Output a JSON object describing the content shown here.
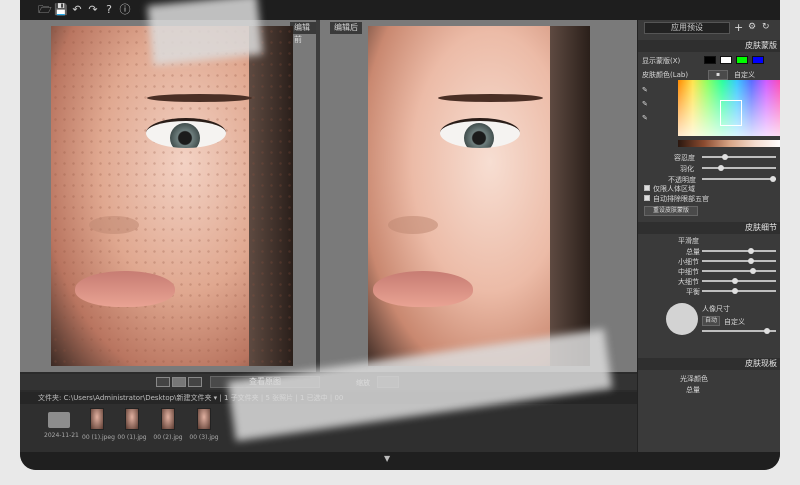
{
  "toolbar": {
    "icons": [
      "open-icon",
      "save-icon",
      "undo-icon",
      "redo-icon",
      "help-icon",
      "info-icon"
    ],
    "glyphs": [
      "🗁",
      "💾",
      "↶",
      "↷",
      "?",
      "ⓘ"
    ]
  },
  "preview": {
    "before_caption": "编辑前",
    "after_caption": "编辑后"
  },
  "viewbar": {
    "view_original_label": "查看原图",
    "zoom_label": "缩放"
  },
  "pathbar": {
    "text": "文件夹: C:\\Users\\Administrator\\Desktop\\新建文件夹 ▾ | 1 子文件夹 | 5 张照片 | 1 已选中 | 00"
  },
  "thumbnails": [
    {
      "label": "2024-11-21",
      "type": "folder"
    },
    {
      "label": "00 (1).jpeg",
      "type": "image"
    },
    {
      "label": "00 (1).jpg",
      "type": "image"
    },
    {
      "label": "00 (2).jpg",
      "type": "image"
    },
    {
      "label": "00 (3).jpg",
      "type": "image"
    }
  ],
  "sidebar": {
    "preset_label": "应用预设",
    "skin_mask": {
      "title": "皮肤蒙版",
      "show_mask_label": "显示蒙版(X)",
      "skin_color_label": "皮肤颜色(Lab)",
      "custom_label": "自定义",
      "tolerance_label": "容忍度",
      "feather_label": "羽化",
      "opacity_label": "不透明度",
      "check1_label": "仅限人体区域",
      "check2_label": "自动排除眼部五官",
      "reset_label": "重设皮肤蒙版"
    },
    "skin_detail": {
      "title": "皮肤细节",
      "smoothness_label": "平滑度",
      "overall_label": "总量",
      "small_label": "小细节",
      "medium_label": "中细节",
      "large_label": "大细节",
      "balance_label": "平衡",
      "portrait_size_label": "人像尺寸",
      "auto_label": "自动",
      "custom_label": "自定义"
    },
    "skin_tone": {
      "title": "皮肤现板",
      "overlay_label": "光泽颜色",
      "overall_label": "总量"
    },
    "swatch_colors": [
      "#000000",
      "#ffffff",
      "#00ff00",
      "#0000ff"
    ]
  }
}
